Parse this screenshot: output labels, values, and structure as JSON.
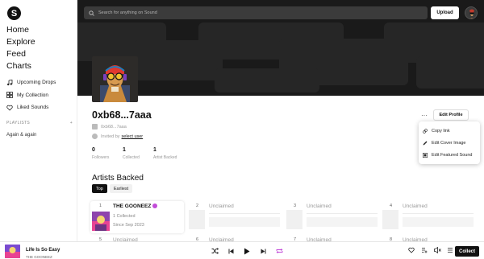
{
  "sidebar": {
    "logo_letter": "S",
    "main_nav": [
      "Home",
      "Explore",
      "Feed",
      "Charts"
    ],
    "sub_nav": [
      {
        "label": "Upcoming Drops",
        "icon": "music-note-icon"
      },
      {
        "label": "My Collection",
        "icon": "grid-icon"
      },
      {
        "label": "Liked Sounds",
        "icon": "heart-icon"
      }
    ],
    "playlists_header": "PLAYLISTS",
    "playlists_add": "+",
    "playlists": [
      "Again & again"
    ]
  },
  "header": {
    "search_placeholder": "Search for anything on Sound",
    "upload_label": "Upload"
  },
  "profile": {
    "handle": "0xb68...7aaa",
    "address": "0xb68...7aaa",
    "invited_prefix": "Invited by",
    "invited_link": "select user",
    "stats": [
      {
        "value": "0",
        "label": "Followers"
      },
      {
        "value": "1",
        "label": "Collected"
      },
      {
        "value": "1",
        "label": "Artist Backed"
      }
    ],
    "more_label": "···",
    "edit_profile_label": "Edit Profile"
  },
  "menu": {
    "items": [
      {
        "label": "Copy link",
        "icon": "link-icon"
      },
      {
        "label": "Edit Cover Image",
        "icon": "pencil-icon"
      },
      {
        "label": "Edit Featured Sound",
        "icon": "image-icon"
      }
    ]
  },
  "artists": {
    "title": "Artists Backed",
    "filters": [
      "Top",
      "Earliest"
    ],
    "claimed": {
      "number": "1",
      "name": "THE GOONEEZ",
      "collected": "1 Collected",
      "since": "Since Sep 2023"
    },
    "unclaimed": [
      {
        "number": "2",
        "name": "Unclaimed"
      },
      {
        "number": "3",
        "name": "Unclaimed"
      },
      {
        "number": "4",
        "name": "Unclaimed"
      },
      {
        "number": "5",
        "name": "Unclaimed"
      },
      {
        "number": "6",
        "name": "Unclaimed"
      },
      {
        "number": "7",
        "name": "Unclaimed"
      },
      {
        "number": "8",
        "name": "Unclaimed"
      }
    ]
  },
  "player": {
    "title": "Life Is So Easy",
    "artist": "THE GOONEEZ",
    "collect_label": "Collect"
  },
  "colors": {
    "banner": "#1a1a1a",
    "accent_repeat": "#c24bd8",
    "verified": "#c24bd8"
  }
}
